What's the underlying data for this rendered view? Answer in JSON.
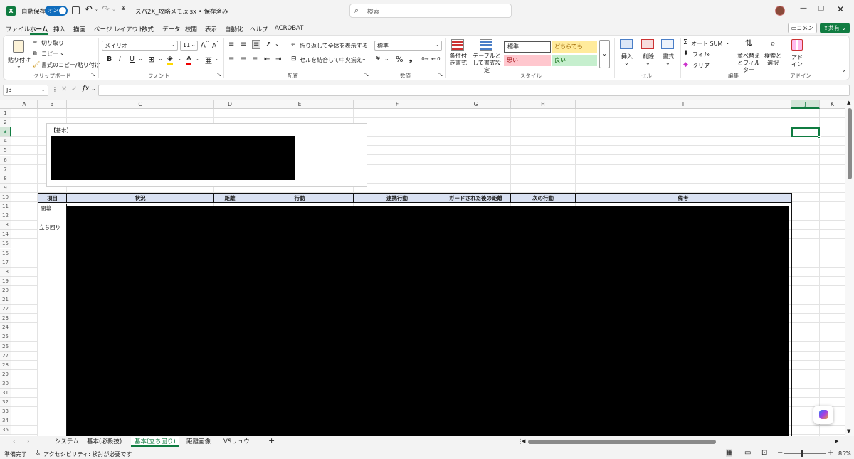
{
  "titlebar": {
    "autosave_label": "自動保存",
    "autosave_toggle": "オン",
    "filename": "スパ2X_攻略メモ.xlsx • 保存済み",
    "search_placeholder": "検索"
  },
  "menu": [
    "ファイル",
    "ホーム",
    "挿入",
    "描画",
    "ページ レイアウト",
    "数式",
    "データ",
    "校閲",
    "表示",
    "自動化",
    "ヘルプ",
    "ACROBAT"
  ],
  "menu_active_index": 1,
  "comment_button": "コメント",
  "share_button": "共有",
  "ribbon": {
    "clipboard": {
      "paste": "貼り付け",
      "cut": "切り取り",
      "copy": "コピー",
      "format_painter": "書式のコピー/貼り付け",
      "label": "クリップボード"
    },
    "font": {
      "name": "メイリオ",
      "size": "11",
      "label": "フォント"
    },
    "alignment": {
      "wrap": "折り返して全体を表示する",
      "merge": "セルを結合して中央揃え",
      "label": "配置"
    },
    "number": {
      "format": "標準",
      "label": "数値"
    },
    "styles": {
      "conditional": "条件付き書式",
      "table": "テーブルとして書式設定",
      "normal": "標準",
      "neutral": "どちらでも...",
      "bad": "悪い",
      "good": "良い",
      "label": "スタイル"
    },
    "cells": {
      "insert": "挿入",
      "delete": "削除",
      "format": "書式",
      "label": "セル"
    },
    "editing": {
      "autosum": "オート SUM",
      "fill": "フィル",
      "clear": "クリア",
      "sort": "並べ替えとフィルター",
      "find": "検索と選択",
      "label": "編集"
    },
    "addins": {
      "addin": "アドイン",
      "label": "アドイン"
    }
  },
  "formula": {
    "namebox": "J3",
    "value": ""
  },
  "columns": [
    "A",
    "B",
    "C",
    "D",
    "E",
    "F",
    "G",
    "H",
    "I",
    "J",
    "K"
  ],
  "rows": [
    "1",
    "2",
    "3",
    "4",
    "5",
    "6",
    "7",
    "8",
    "9",
    "10",
    "11",
    "12",
    "13",
    "14",
    "15",
    "16",
    "17",
    "18",
    "19",
    "20",
    "21",
    "22",
    "23",
    "24",
    "25",
    "26",
    "27",
    "28",
    "29",
    "30",
    "31",
    "32",
    "33",
    "34",
    "35"
  ],
  "box_title": "【基本】",
  "table_headers": [
    "項目",
    "状況",
    "距離",
    "行動",
    "連携行動",
    "ガードされた後の距離",
    "次の行動",
    "備考"
  ],
  "table_rows": [
    "開幕",
    "立ち回り"
  ],
  "sheets": [
    "システム",
    "基本(必殺技)",
    "基本(立ち回り)",
    "距離画像",
    "VSリュウ"
  ],
  "active_sheet_index": 2,
  "status": {
    "ready": "準備完了",
    "accessibility": "アクセシビリティ: 検討が必要です",
    "zoom": "85%"
  }
}
